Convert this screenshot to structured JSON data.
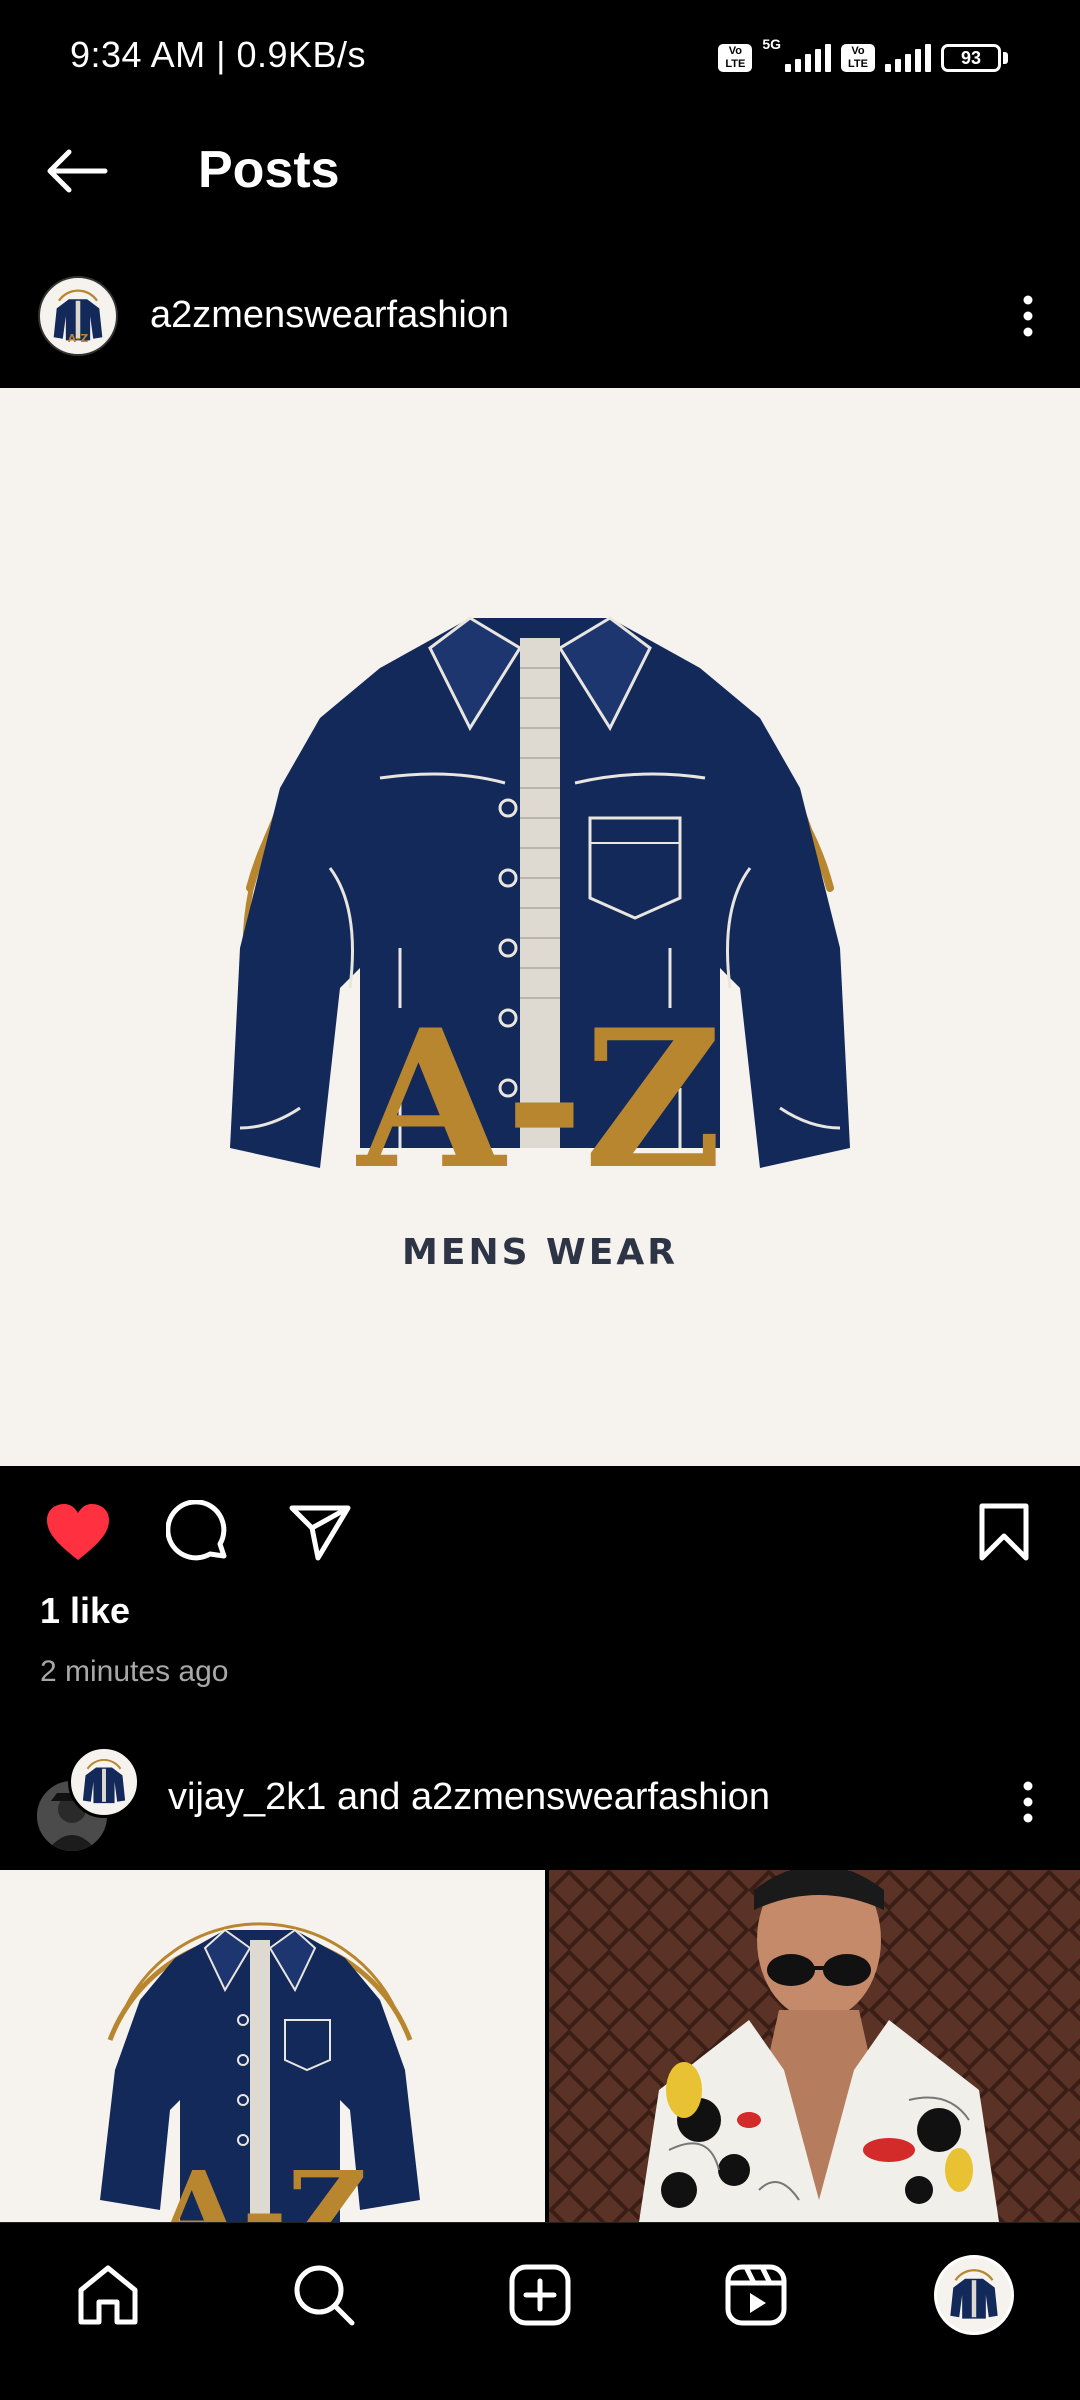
{
  "status_bar": {
    "time_speed": "9:34 AM | 0.9KB/s",
    "volte_label": "Vo LTE",
    "network": "5G",
    "battery": "93"
  },
  "header": {
    "title": "Posts",
    "back_icon": "arrow-left-icon"
  },
  "post": {
    "username": "a2zmenswearfashion",
    "image_brand": "A-Z",
    "image_tagline": "MENS WEAR",
    "liked": true,
    "like_color": "#ff3040",
    "likes_text": "1 like",
    "timestamp": "2 minutes ago"
  },
  "post2": {
    "user1": "vijay_2k1",
    "connector": " and ",
    "user2": "a2zmenswearfashion"
  },
  "bottom_nav": {
    "items": [
      "home-icon",
      "search-icon",
      "create-icon",
      "reels-icon",
      "profile-avatar"
    ]
  },
  "colors": {
    "background": "#000000",
    "logo_navy": "#13295a",
    "logo_gold": "#b8862f",
    "logo_cream": "#f6f3ee"
  }
}
